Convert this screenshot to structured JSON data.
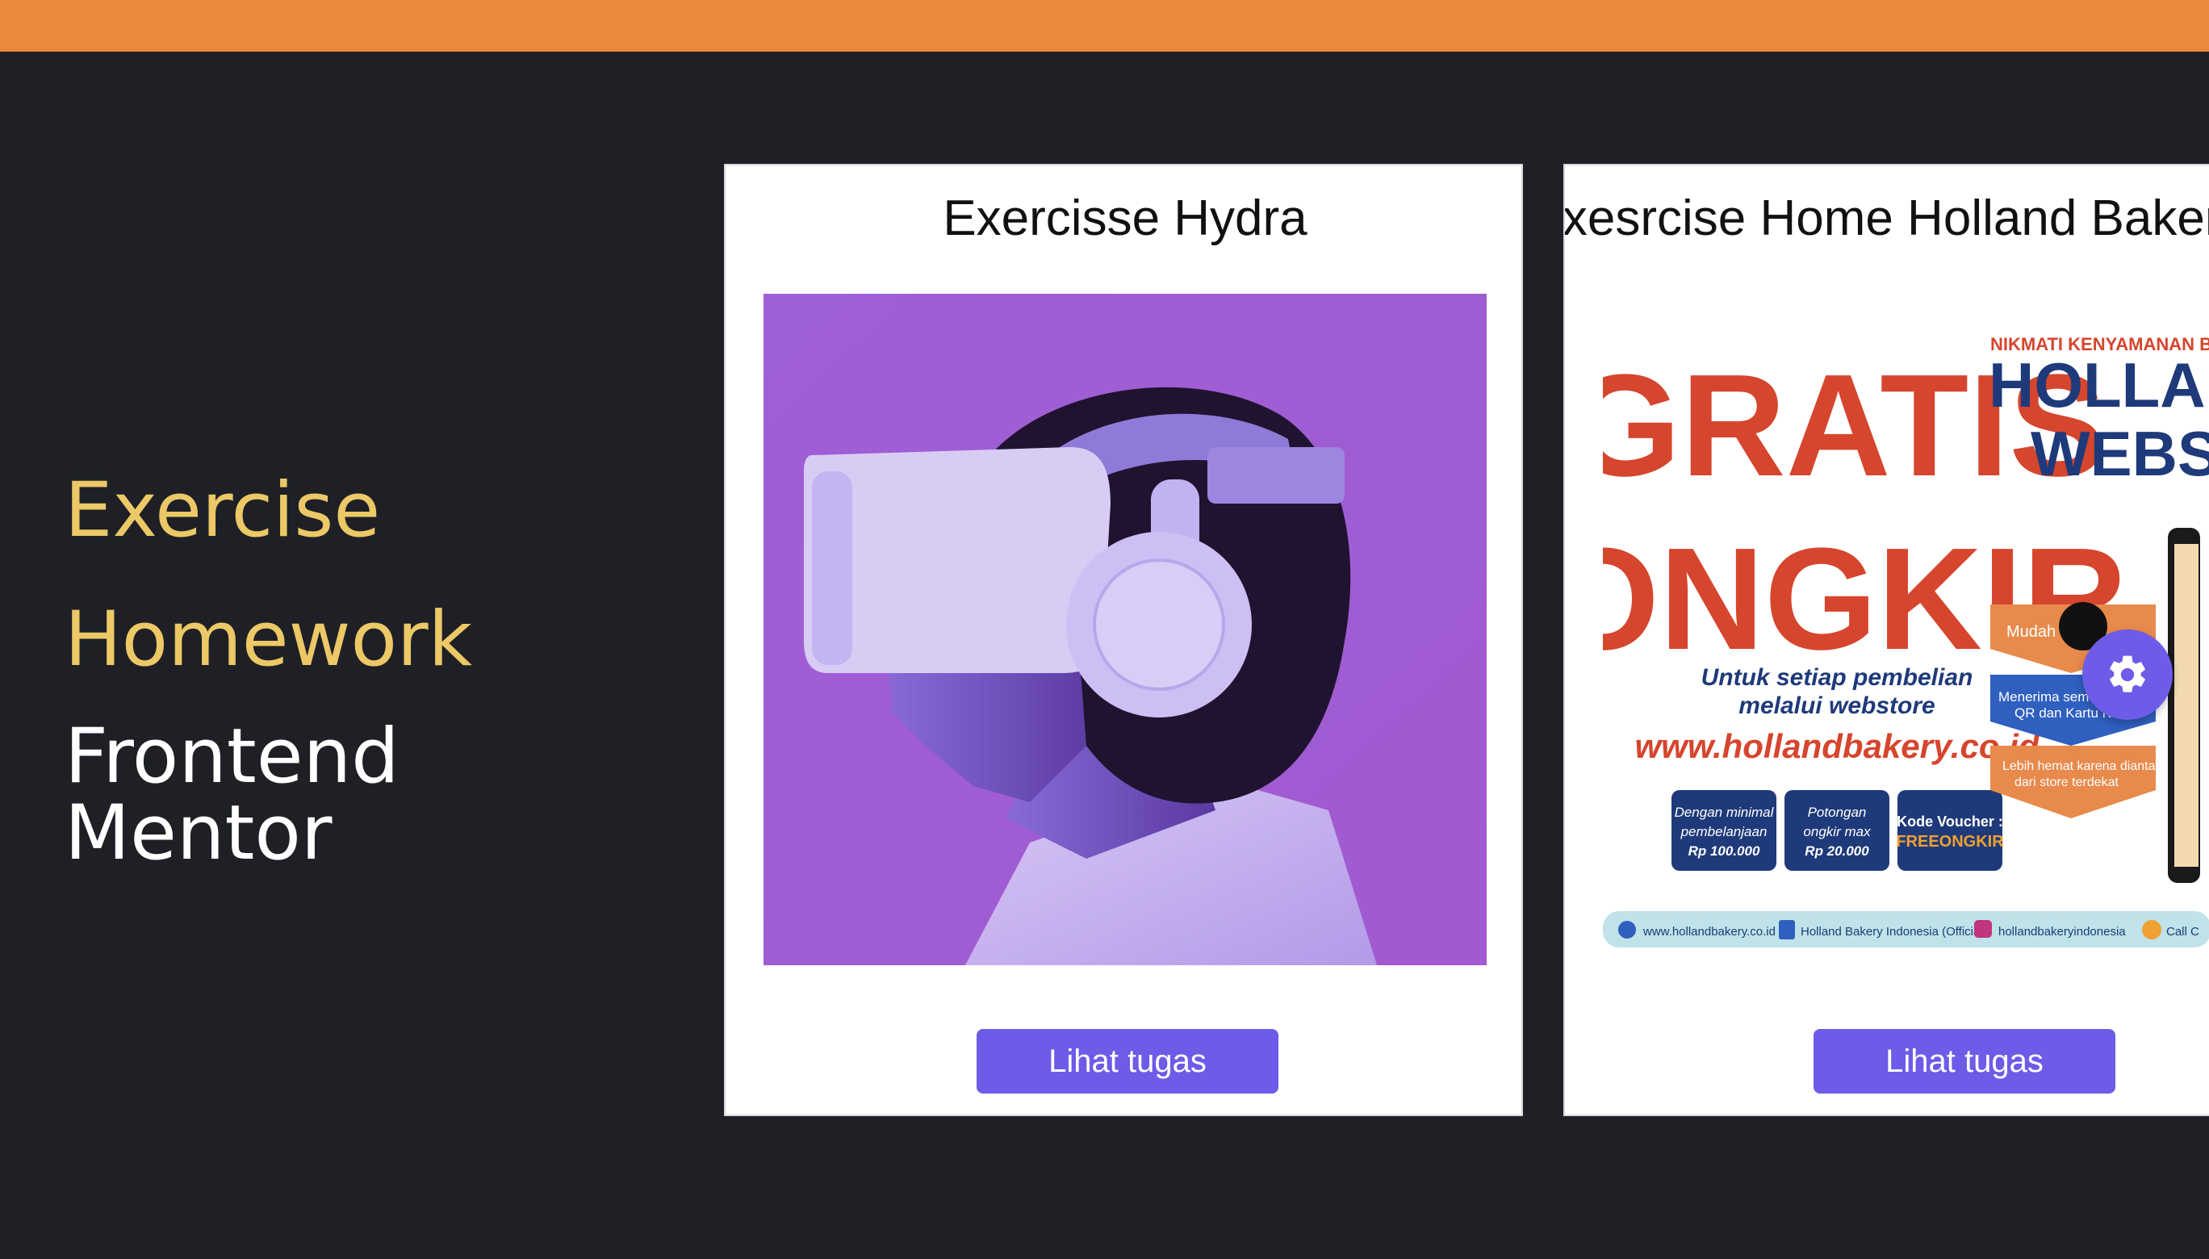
{
  "colors": {
    "topbar": "#ea883c",
    "background": "#1e2026",
    "accent_yellow": "#ecc866",
    "button": "#6c5ce7"
  },
  "sidebar": {
    "line1": "Exercise",
    "line2": "Homework",
    "line3": "Frontend",
    "line4": "Mentor"
  },
  "cards": [
    {
      "title": "Exercisse Hydra",
      "image_icon": "vr-headset-photo",
      "button_label": "Lihat tugas"
    },
    {
      "title": "Exesrcise Home Holland Bakery",
      "image_icon": "holland-bakery-promo-banner",
      "button_label": "Lihat tugas",
      "banner": {
        "headline1": "GRATIS",
        "headline2": "ONGKIR",
        "subtitle1": "Untuk setiap pembelian",
        "subtitle2": "melalui webstore",
        "url": "www.hollandbakery.co.id",
        "right_header": "NIKMATI KENYAMANAN BE",
        "brand1": "HOLLAND BA",
        "brand2": "WEBSTO",
        "box1": [
          "Dengan minimal",
          "pembelanjaan",
          "Rp 100.000"
        ],
        "box2": [
          "Potongan",
          "ongkir max",
          "Rp 20.000"
        ],
        "box3": [
          "Kode Voucher :",
          "FREEONGKIR"
        ],
        "badge1": "Mudah dan s",
        "badge2": [
          "Menerima semua",
          "QR dan Kartu K"
        ],
        "badge3": [
          "Lebih hemat karena diantar",
          "dari store terdekat"
        ],
        "footer1": "www.hollandbakery.co.id",
        "footer2": "Holland Bakery Indonesia (Official)",
        "footer3": "hollandbakeryindonesia",
        "footer4": "Call C"
      }
    }
  ],
  "settings_icon": "gear-icon"
}
